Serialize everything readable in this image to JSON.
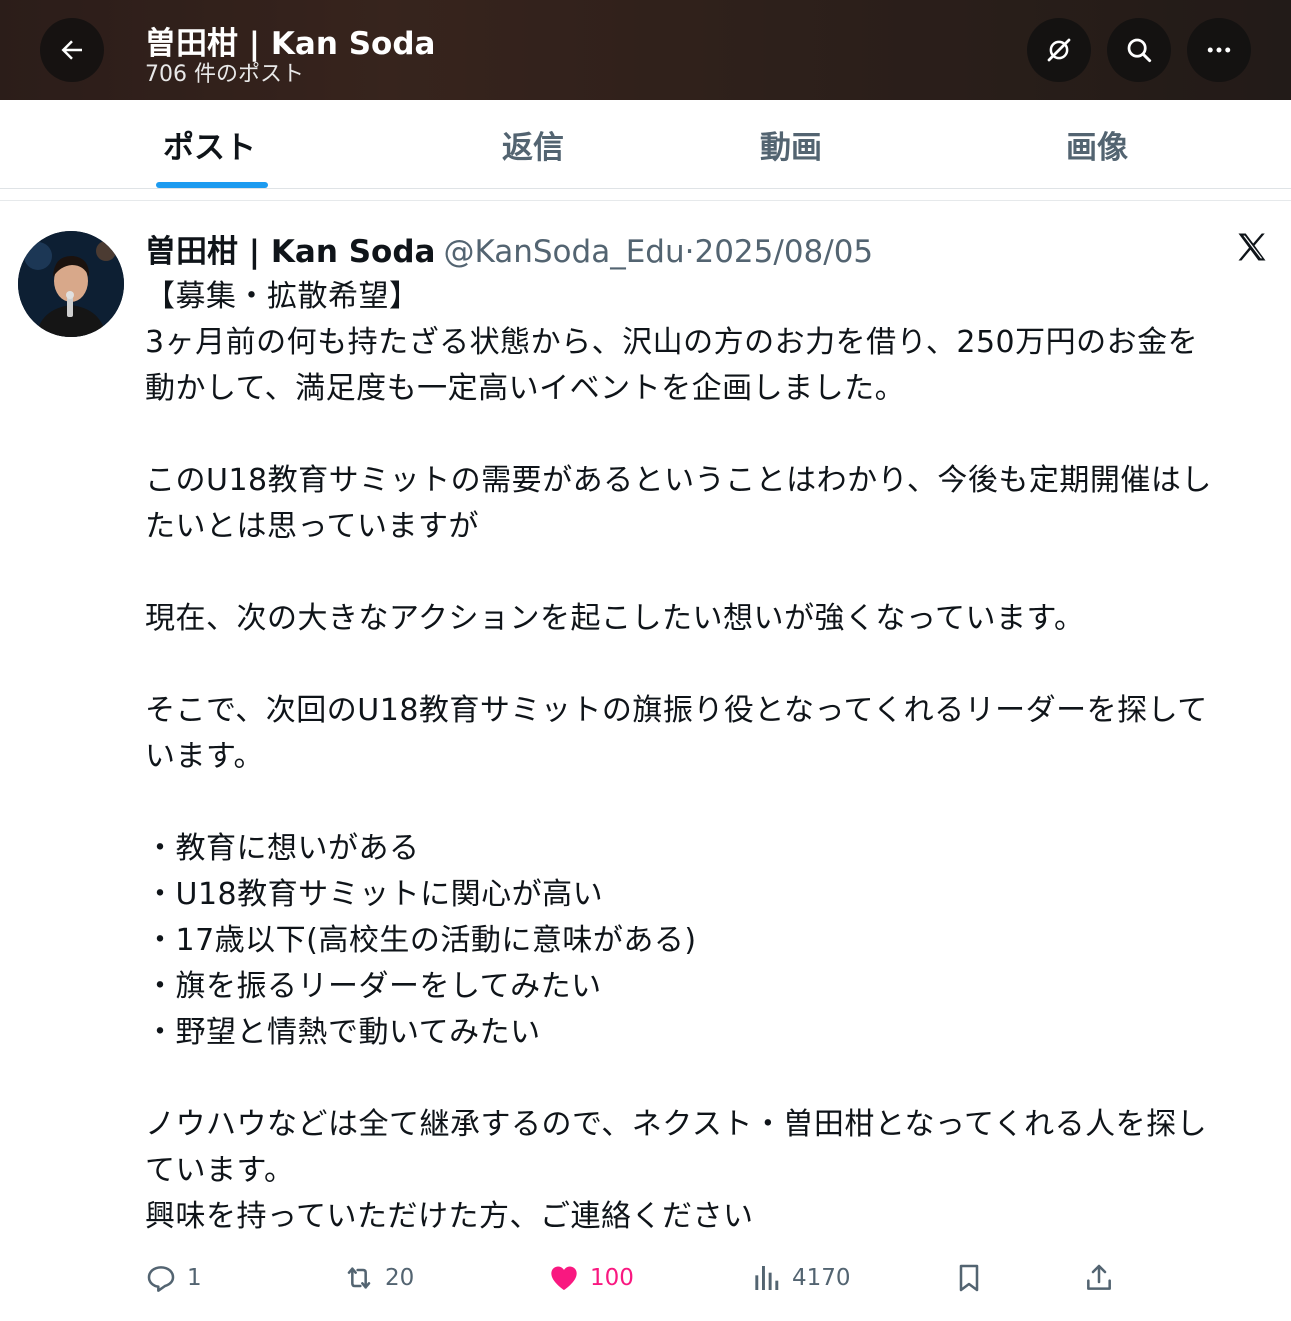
{
  "header": {
    "title": "曽田柑 | Kan Soda",
    "subtitle": "706 件のポスト",
    "icons": [
      "back-arrow-icon",
      "sync-icon",
      "search-icon",
      "more-icon"
    ]
  },
  "tabs": [
    {
      "label": "ポスト",
      "active": true
    },
    {
      "label": "返信",
      "active": false
    },
    {
      "label": "動画",
      "active": false
    },
    {
      "label": "画像",
      "active": false
    }
  ],
  "post": {
    "author_name": "曽田柑 | Kan Soda",
    "handle": "@KanSoda_Edu",
    "separator": "·",
    "date": "2025/08/05",
    "body": "【募集・拡散希望】\n3ヶ月前の何も持たざる状態から、沢山の方のお力を借り、250万円のお金を\n動かして、満足度も一定高いイベントを企画しました。\n\nこのU18教育サミットの需要があるということはわかり、今後も定期開催はし\nたいとは思っていますが\n\n現在、次の大きなアクションを起こしたい想いが強くなっています。\n\nそこで、次回のU18教育サミットの旗振り役となってくれるリーダーを探して\nいます。\n\n・教育に想いがある\n・U18教育サミットに関心が高い\n・17歳以下(高校生の活動に意味がある)\n・旗を振るリーダーをしてみたい\n・野望と情熱で動いてみたい\n\nノウハウなどは全て継承するので、ネクスト・曽田柑となってくれる人を探し\nています。\n興味を持っていただけた方、ご連絡ください",
    "actions": {
      "replies": "1",
      "reposts": "20",
      "likes": "100",
      "views": "4170"
    }
  },
  "colors": {
    "accent": "#1d9bf0",
    "like": "#f91880",
    "secondary_text": "#536471"
  }
}
